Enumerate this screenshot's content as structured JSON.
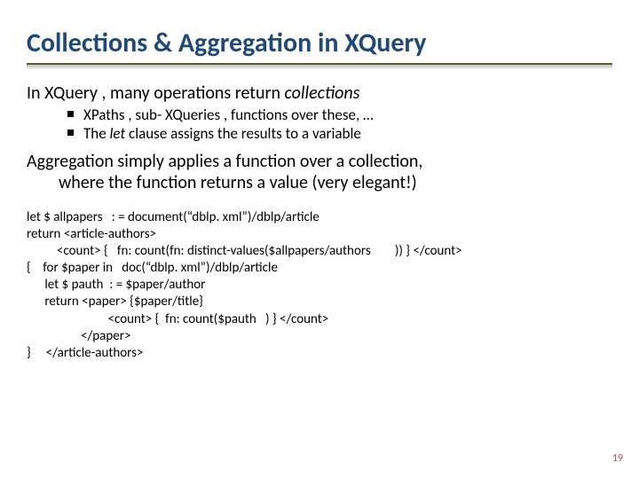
{
  "title": "Collections & Aggregation in XQuery",
  "line1_a": "In  XQuery , many operations return ",
  "line1_b": "collections",
  "bullets": [
    {
      "text": "XPaths , sub- XQueries , functions over these, …"
    },
    {
      "a": "The  ",
      "b": "let",
      "c": "  clause assigns the results to a variable"
    }
  ],
  "agg_l1": "Aggregation simply applies a function over a collection,",
  "agg_l2": "where the function returns a value (very elegant!)",
  "code": {
    "l1": "let $ allpapers   : = document(“dblp. xml”)/dblp/article",
    "l2": "return <article-authors>",
    "l3": "          <count> {   fn: count(fn: distinct-values($allpapers/authors        )) } </count>",
    "l4": "{    for $paper in   doc(“dblp. xml”)/dblp/article",
    "l5": "      let $ pauth  : = $paper/author",
    "l6": "      return <paper> {$paper/title}",
    "l7": "                           <count> {  fn: count($pauth   ) } </count>",
    "l8": "                  </paper>",
    "l9": "}     </article-authors>"
  },
  "slide_number": "19"
}
